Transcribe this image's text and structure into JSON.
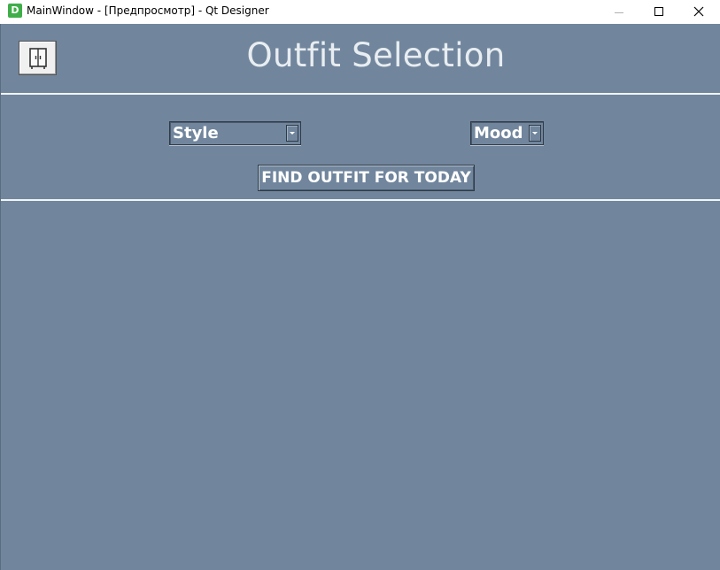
{
  "window": {
    "app_icon_letter": "D",
    "title": "MainWindow - [Предпросмотр] - Qt Designer"
  },
  "main": {
    "heading": "Outfit Selection",
    "style_combo": {
      "selected": "Style"
    },
    "mood_combo": {
      "selected": "Mood"
    },
    "find_button_label": "FIND OUTFIT FOR TODAY"
  },
  "colors": {
    "background": "#71869d",
    "heading_text": "#e8edf1",
    "separator": "#f2f4f6",
    "app_icon": "#3fae49"
  },
  "icons": {
    "wardrobe_button": "wardrobe-icon"
  }
}
